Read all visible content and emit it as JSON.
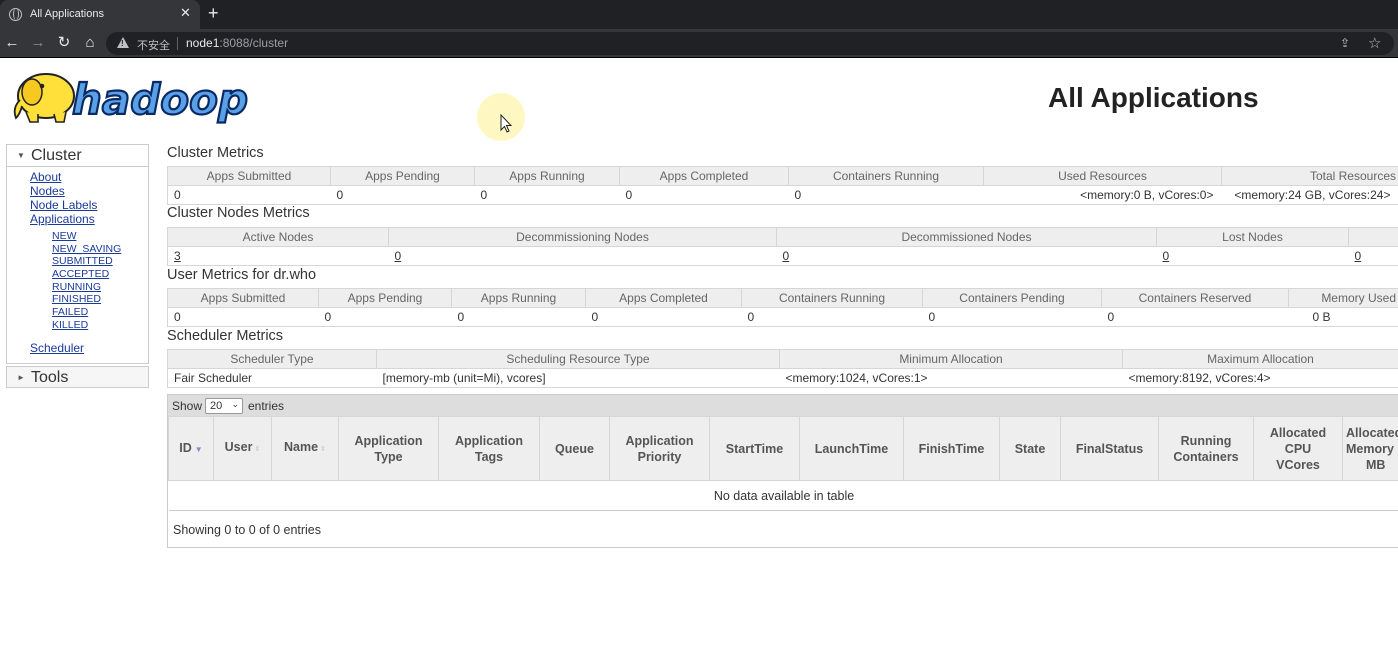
{
  "browser": {
    "tab_title": "All Applications",
    "tab_close": "✕",
    "new_tab": "+",
    "insecure_label": "不安全",
    "url_host": "node1",
    "url_rest": ":8088/cluster"
  },
  "logo_text": "hadoop",
  "page_title": "All Applications",
  "sidebar": {
    "cluster_title": "Cluster",
    "links": [
      "About",
      "Nodes",
      "Node Labels",
      "Applications"
    ],
    "app_states": [
      "NEW",
      "NEW_SAVING",
      "SUBMITTED",
      "ACCEPTED",
      "RUNNING",
      "FINISHED",
      "FAILED",
      "KILLED"
    ],
    "scheduler_link": "Scheduler",
    "tools_title": "Tools"
  },
  "cluster_metrics": {
    "title": "Cluster Metrics",
    "headers": [
      "Apps Submitted",
      "Apps Pending",
      "Apps Running",
      "Apps Completed",
      "Containers Running",
      "Used Resources",
      "Total Resources"
    ],
    "values": [
      "0",
      "0",
      "0",
      "0",
      "0",
      "<memory:0 B, vCores:0>",
      "<memory:24 GB, vCores:24>"
    ]
  },
  "cluster_nodes_metrics": {
    "title": "Cluster Nodes Metrics",
    "headers": [
      "Active Nodes",
      "Decommissioning Nodes",
      "Decommissioned Nodes",
      "Lost Nodes"
    ],
    "values": [
      "3",
      "0",
      "0",
      "0",
      "0"
    ]
  },
  "user_metrics": {
    "title": "User Metrics for dr.who",
    "headers": [
      "Apps Submitted",
      "Apps Pending",
      "Apps Running",
      "Apps Completed",
      "Containers Running",
      "Containers Pending",
      "Containers Reserved",
      "Memory Used"
    ],
    "values": [
      "0",
      "0",
      "0",
      "0",
      "0",
      "0",
      "0",
      "0 B"
    ]
  },
  "scheduler_metrics": {
    "title": "Scheduler Metrics",
    "headers": [
      "Scheduler Type",
      "Scheduling Resource Type",
      "Minimum Allocation",
      "Maximum Allocation"
    ],
    "values": [
      "Fair Scheduler",
      "[memory-mb (unit=Mi), vcores]",
      "<memory:1024, vCores:1>",
      "<memory:8192, vCores:4>"
    ]
  },
  "apps_table": {
    "show_label": "Show",
    "page_length": "20",
    "entries_label": "entries",
    "columns": [
      [
        "ID"
      ],
      [
        "User"
      ],
      [
        "Name"
      ],
      [
        "Application",
        "Type"
      ],
      [
        "Application",
        "Tags"
      ],
      [
        "Queue"
      ],
      [
        "Application",
        "Priority"
      ],
      [
        "StartTime"
      ],
      [
        "LaunchTime"
      ],
      [
        "FinishTime"
      ],
      [
        "State"
      ],
      [
        "FinalStatus"
      ],
      [
        "Running",
        "Containers"
      ],
      [
        "Allocated",
        "CPU",
        "VCores"
      ],
      [
        "Allocated",
        "Memory",
        "MB"
      ]
    ],
    "empty_message": "No data available in table",
    "info": "Showing 0 to 0 of 0 entries"
  }
}
